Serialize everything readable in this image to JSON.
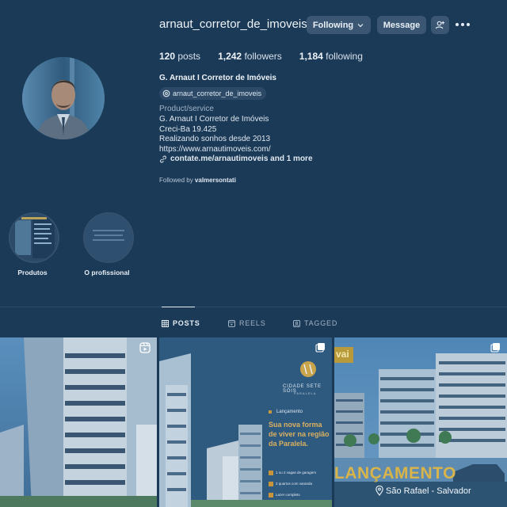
{
  "header": {
    "username": "arnaut_corretor_de_imoveis",
    "following_button": "Following",
    "message_button": "Message"
  },
  "stats": {
    "posts_count": "120",
    "posts_label": "posts",
    "followers_count": "1,242",
    "followers_label": "followers",
    "following_count": "1,184",
    "following_label": "following"
  },
  "profile": {
    "full_name": "G. Arnaut I Corretor de Imóveis",
    "threads_handle": "arnaut_corretor_de_imoveis",
    "category": "Product/service",
    "bio_lines": [
      "G. Arnaut I Corretor de Imóveis",
      "Creci-Ba 19.425",
      "Realizando sonhos desde 2013",
      "https://www.arnautimoveis.com/"
    ],
    "links_text": "contate.me/arnautimoveis and 1 more",
    "followed_by_prefix": "Followed by",
    "followed_by_user": "valmersontati"
  },
  "highlights": [
    {
      "label": "Produtos"
    },
    {
      "label": "O profissional"
    }
  ],
  "tabs": [
    {
      "label": "POSTS",
      "active": true
    },
    {
      "label": "REELS",
      "active": false
    },
    {
      "label": "TAGGED",
      "active": false
    }
  ],
  "posts": [
    {
      "type": "reel"
    },
    {
      "type": "carousel",
      "brand_title": "CIDADE SETE SÓIS",
      "brand_sub": "PARALELA",
      "tag": "Lançamento",
      "headline": "Sua nova forma de viver na região da Paralela.",
      "features": [
        "1 ou 2 vagas de garagem",
        "2 quartos com varanda",
        "Lazer completo"
      ]
    },
    {
      "type": "carousel",
      "banner": "LANÇAMENTO",
      "location": "São Rafael - Salvador",
      "corner_text": "vai"
    }
  ],
  "colors": {
    "background": "#1b3a57",
    "button": "#3a5673",
    "text": "#e6edf4",
    "muted": "#9fb3c7"
  }
}
